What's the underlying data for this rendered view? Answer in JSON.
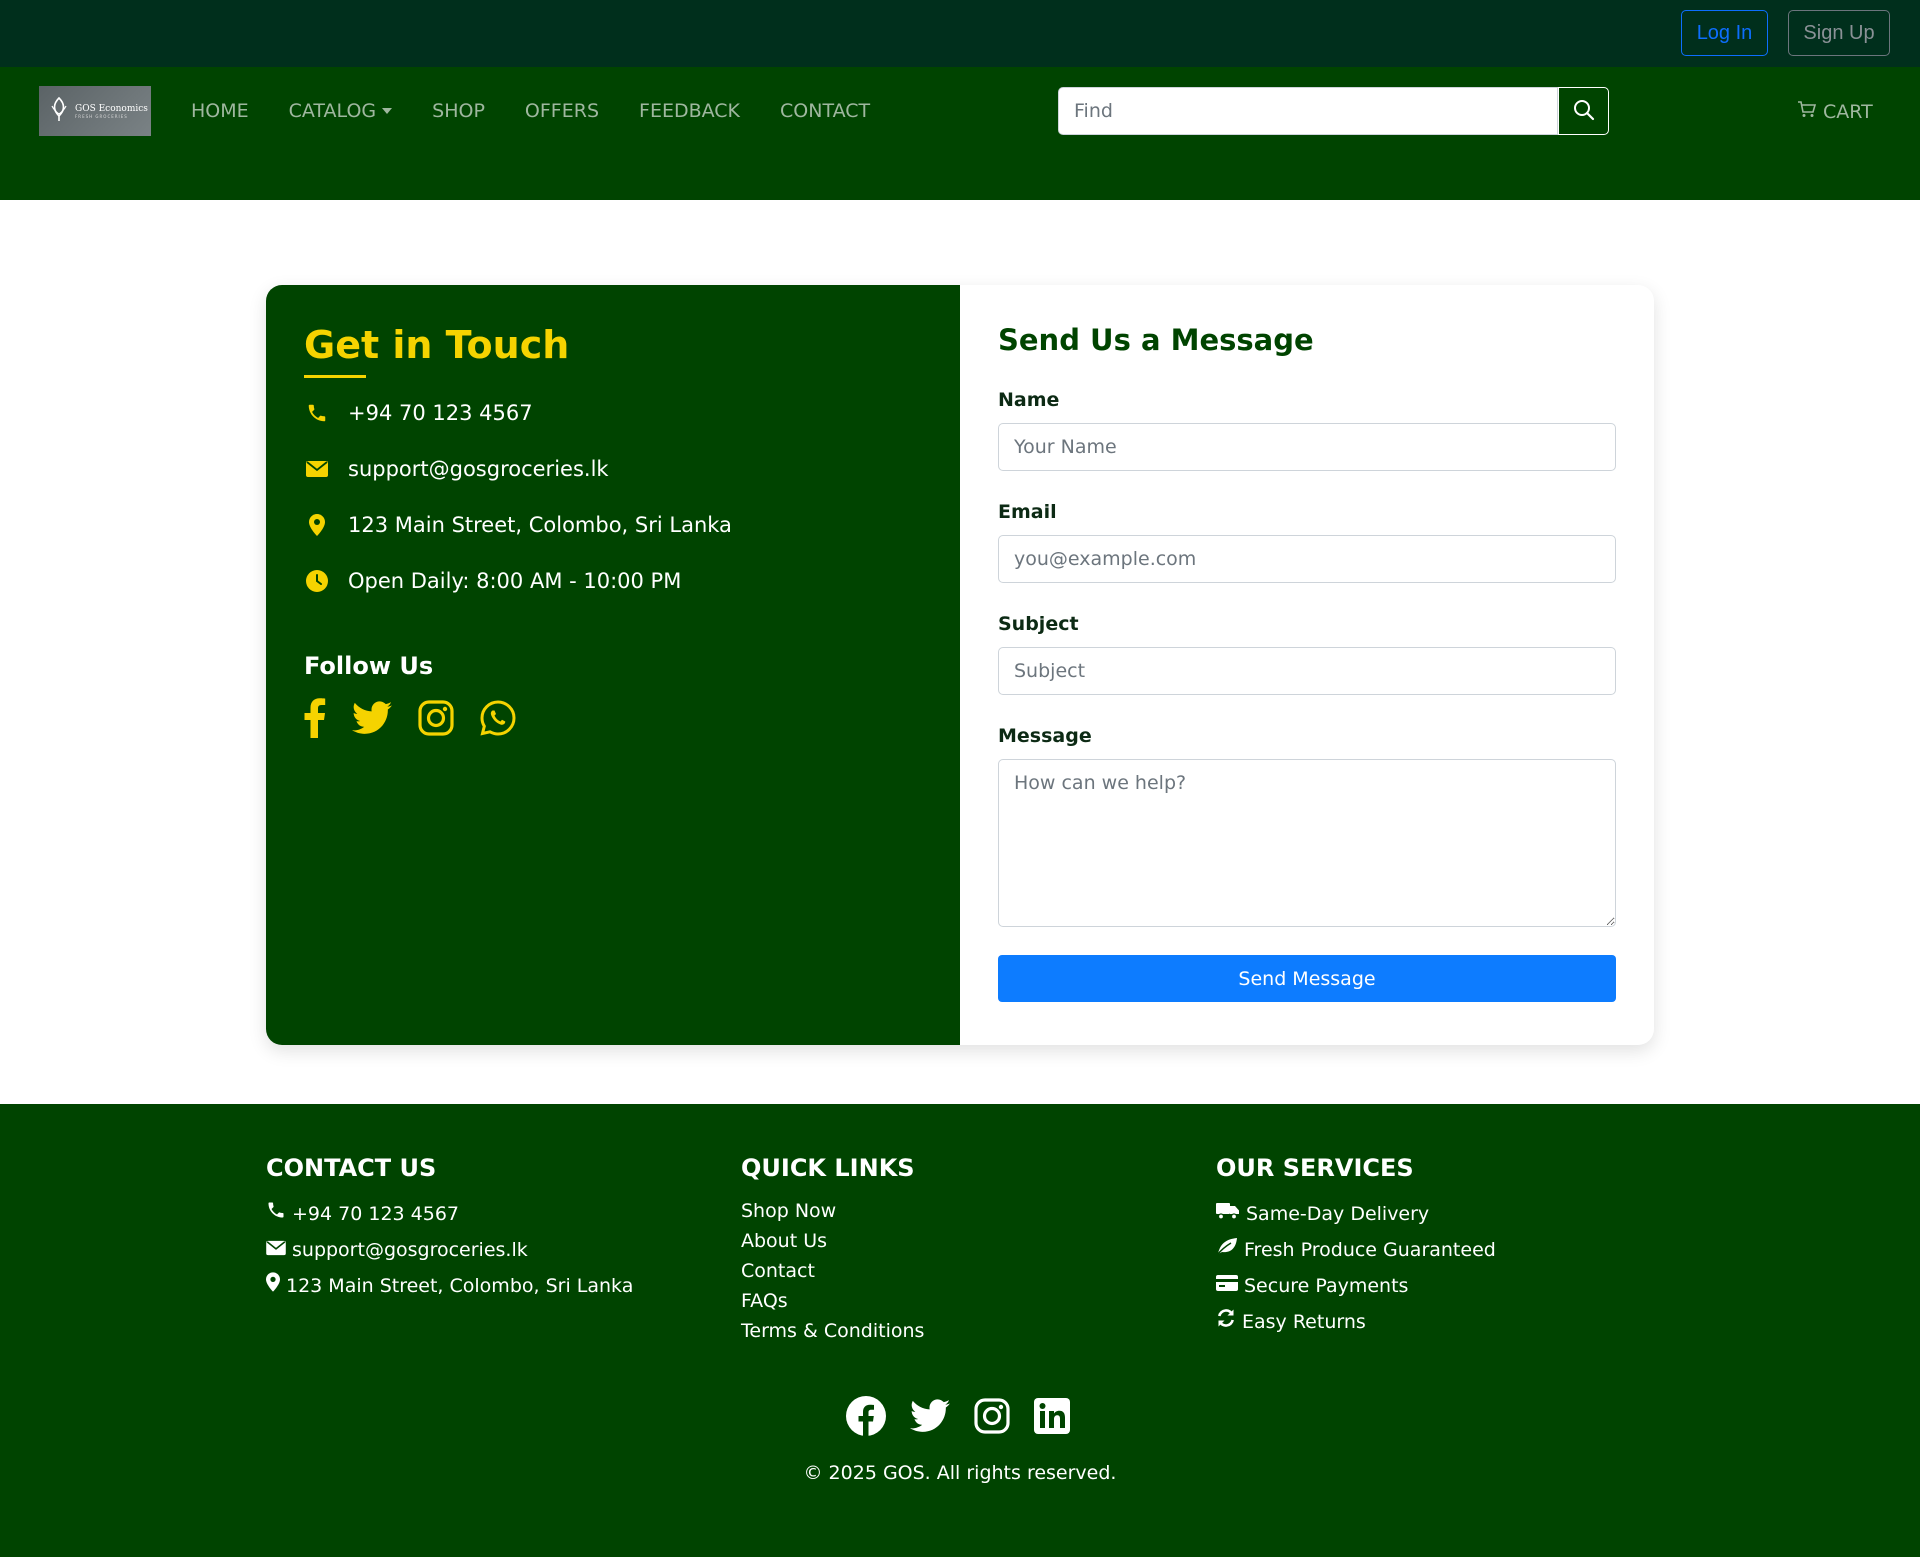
{
  "topbar": {
    "login_label": "Log In",
    "signup_label": "Sign Up"
  },
  "brand": {
    "logo_title": "GOS Economics",
    "logo_subtitle": "FRESH GROCERIES"
  },
  "nav": {
    "items": [
      {
        "label": "HOME"
      },
      {
        "label": "CATALOG",
        "dropdown": true
      },
      {
        "label": "SHOP"
      },
      {
        "label": "OFFERS"
      },
      {
        "label": "FEEDBACK"
      },
      {
        "label": "CONTACT"
      }
    ],
    "search_placeholder": "Find",
    "cart_label": "CART"
  },
  "contact_card": {
    "title": "Get in Touch",
    "phone": "+94 70 123 4567",
    "email": "support@gosgroceries.lk",
    "address": "123 Main Street, Colombo, Sri Lanka",
    "hours": "Open Daily: 8:00 AM - 10:00 PM",
    "follow_title": "Follow Us",
    "social_icons": [
      "facebook-icon",
      "twitter-icon",
      "instagram-icon",
      "whatsapp-icon"
    ]
  },
  "form": {
    "title": "Send Us a Message",
    "name_label": "Name",
    "name_placeholder": "Your Name",
    "email_label": "Email",
    "email_placeholder": "you@example.com",
    "subject_label": "Subject",
    "subject_placeholder": "Subject",
    "message_label": "Message",
    "message_placeholder": "How can we help?",
    "submit_label": "Send Message"
  },
  "footer": {
    "contact_title": "CONTACT US",
    "contact_phone": "+94 70 123 4567",
    "contact_email": "support@gosgroceries.lk",
    "contact_address": "123 Main Street, Colombo, Sri Lanka",
    "links_title": "QUICK LINKS",
    "links": [
      "Shop Now",
      "About Us",
      "Contact",
      "FAQs",
      "Terms & Conditions"
    ],
    "services_title": "OUR SERVICES",
    "services": [
      "Same-Day Delivery",
      "Fresh Produce Guaranteed",
      "Secure Payments",
      "Easy Returns"
    ],
    "social_icons": [
      "facebook-icon",
      "twitter-icon",
      "instagram-icon",
      "linkedin-icon"
    ],
    "copyright": "© 2025 GOS. All rights reserved."
  },
  "colors": {
    "topbar": "#002f1c",
    "primary_green": "#004400",
    "accent_yellow": "#f5d300",
    "button_blue": "#0d7cff"
  }
}
